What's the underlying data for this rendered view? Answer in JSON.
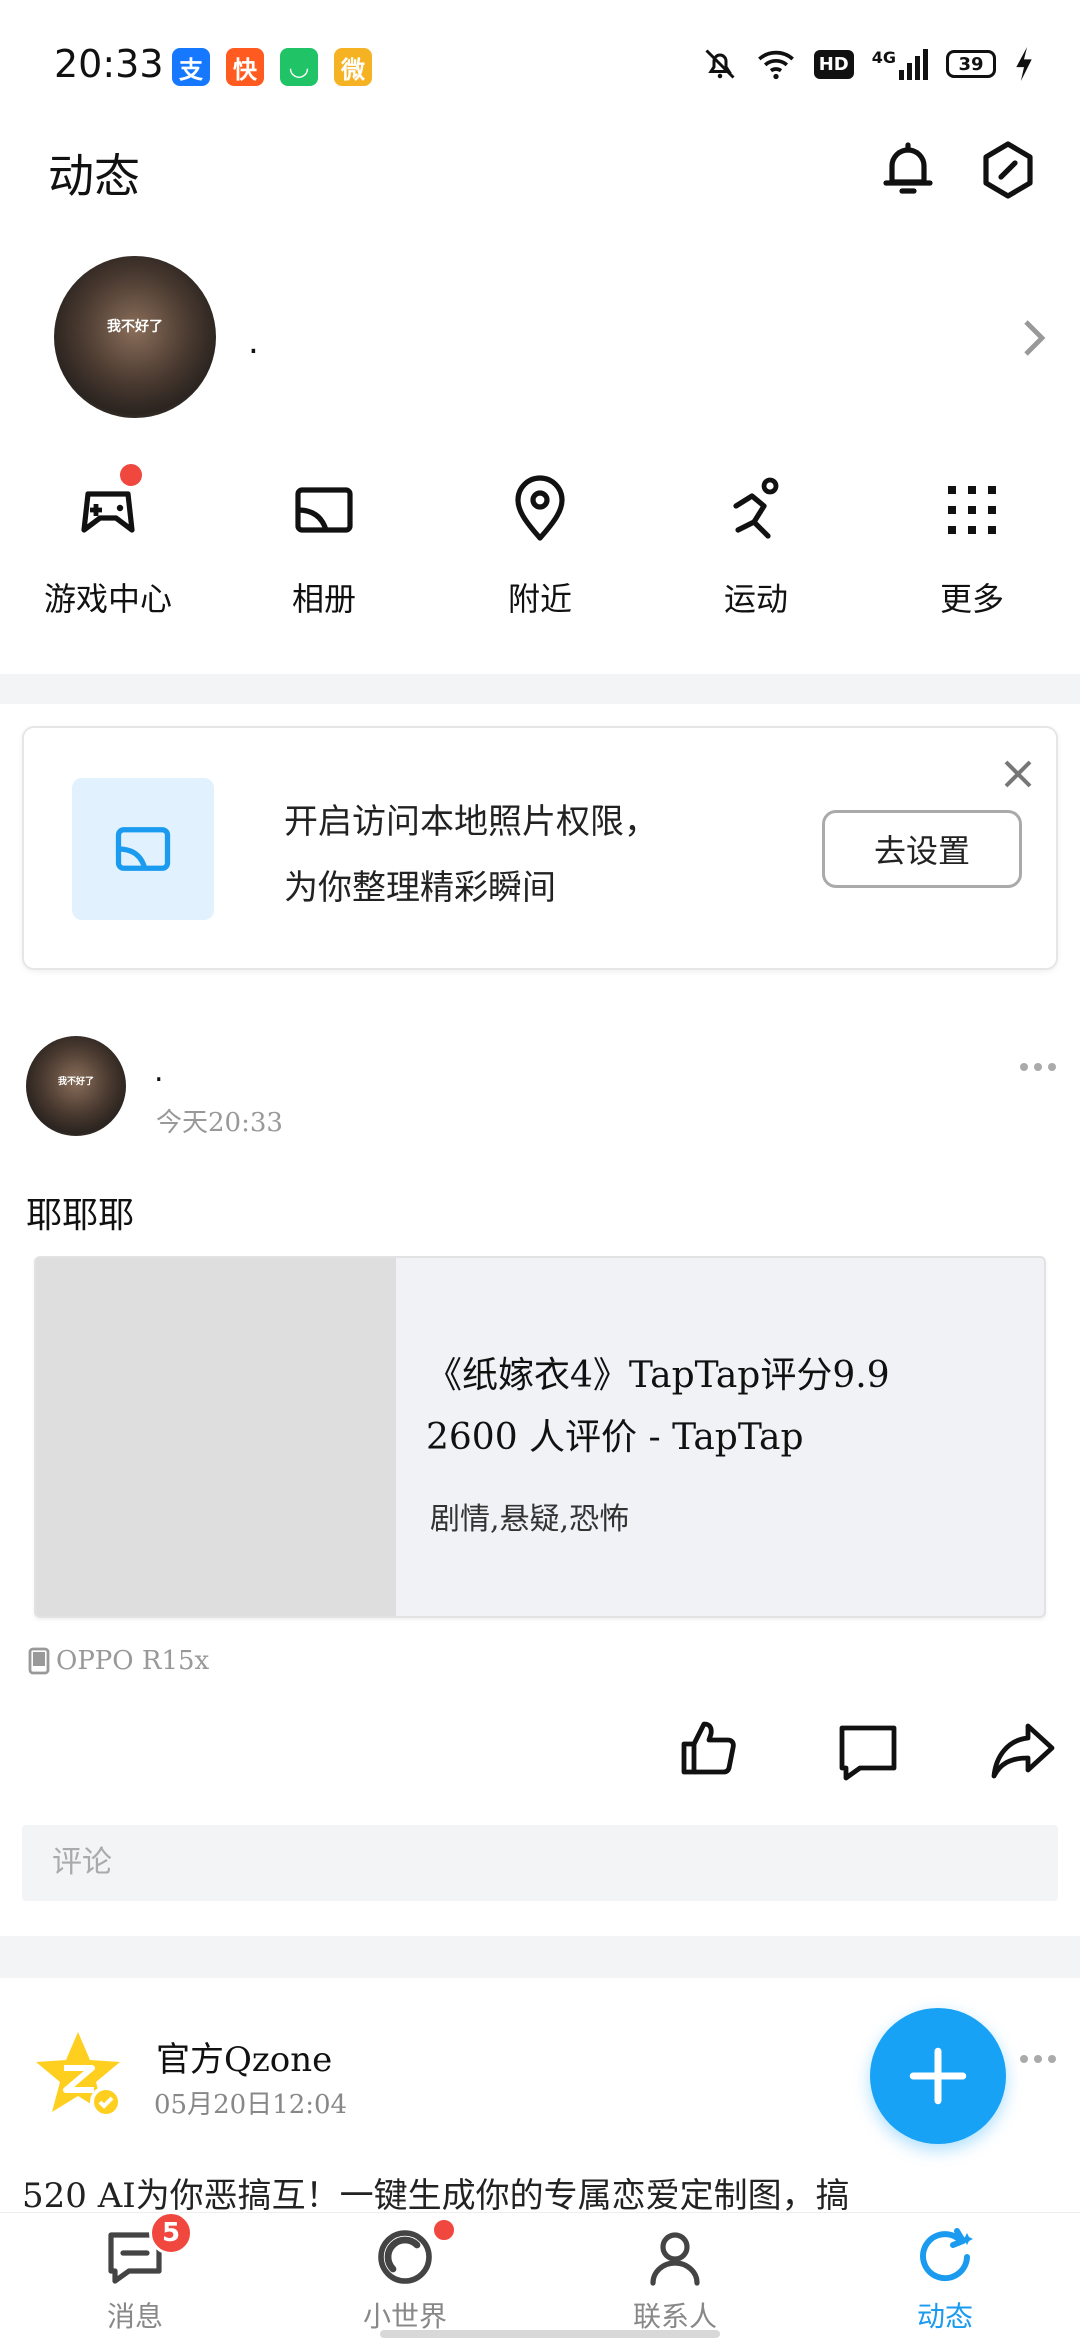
{
  "status_bar": {
    "time": "20:33",
    "battery": "39",
    "network": "4G",
    "hd": "HD",
    "apps": [
      {
        "name": "alipay-icon",
        "glyph": "支",
        "color": "#1677ff"
      },
      {
        "name": "kuaishou-icon",
        "glyph": "快",
        "color": "#ff5a1f"
      },
      {
        "name": "mini-app-icon",
        "glyph": "◡",
        "color": "#20c466"
      },
      {
        "name": "weibo-icon",
        "glyph": "微",
        "color": "#f5b324"
      }
    ]
  },
  "header": {
    "title": "动态"
  },
  "profile": {
    "name": ".",
    "avatar_text": "我不好了"
  },
  "shortcuts": [
    {
      "label": "游戏中心",
      "icon": "gamepad-icon"
    },
    {
      "label": "相册",
      "icon": "album-icon"
    },
    {
      "label": "附近",
      "icon": "location-pin-icon"
    },
    {
      "label": "运动",
      "icon": "running-icon"
    },
    {
      "label": "更多",
      "icon": "grid-dots-icon"
    }
  ],
  "permission_card": {
    "line1": "开启访问本地照片权限，",
    "line2": "为你整理精彩瞬间",
    "button": "去设置"
  },
  "post": {
    "author": ".",
    "time": "今天20:33",
    "text": "耶耶耶",
    "link": {
      "title_line1": "《纸嫁衣4》TapTap评分9.9",
      "title_line2": "2600 人评价 - TapTap",
      "tags": "剧情,悬疑,恐怖"
    },
    "device": "OPPO R15x",
    "comment_placeholder": "评论"
  },
  "post2": {
    "author": "官方Qzone",
    "time": "05月20日12:04",
    "text": "520 AI为你恶搞互！一键生成你的专属恋爱定制图，搞"
  },
  "bottom_nav": [
    {
      "label": "消息",
      "badge": "5"
    },
    {
      "label": "小世界"
    },
    {
      "label": "联系人"
    },
    {
      "label": "动态"
    }
  ],
  "colors": {
    "accent": "#1a9bf0",
    "badge_red": "#f0473e",
    "fab_blue": "#17a2f6"
  }
}
